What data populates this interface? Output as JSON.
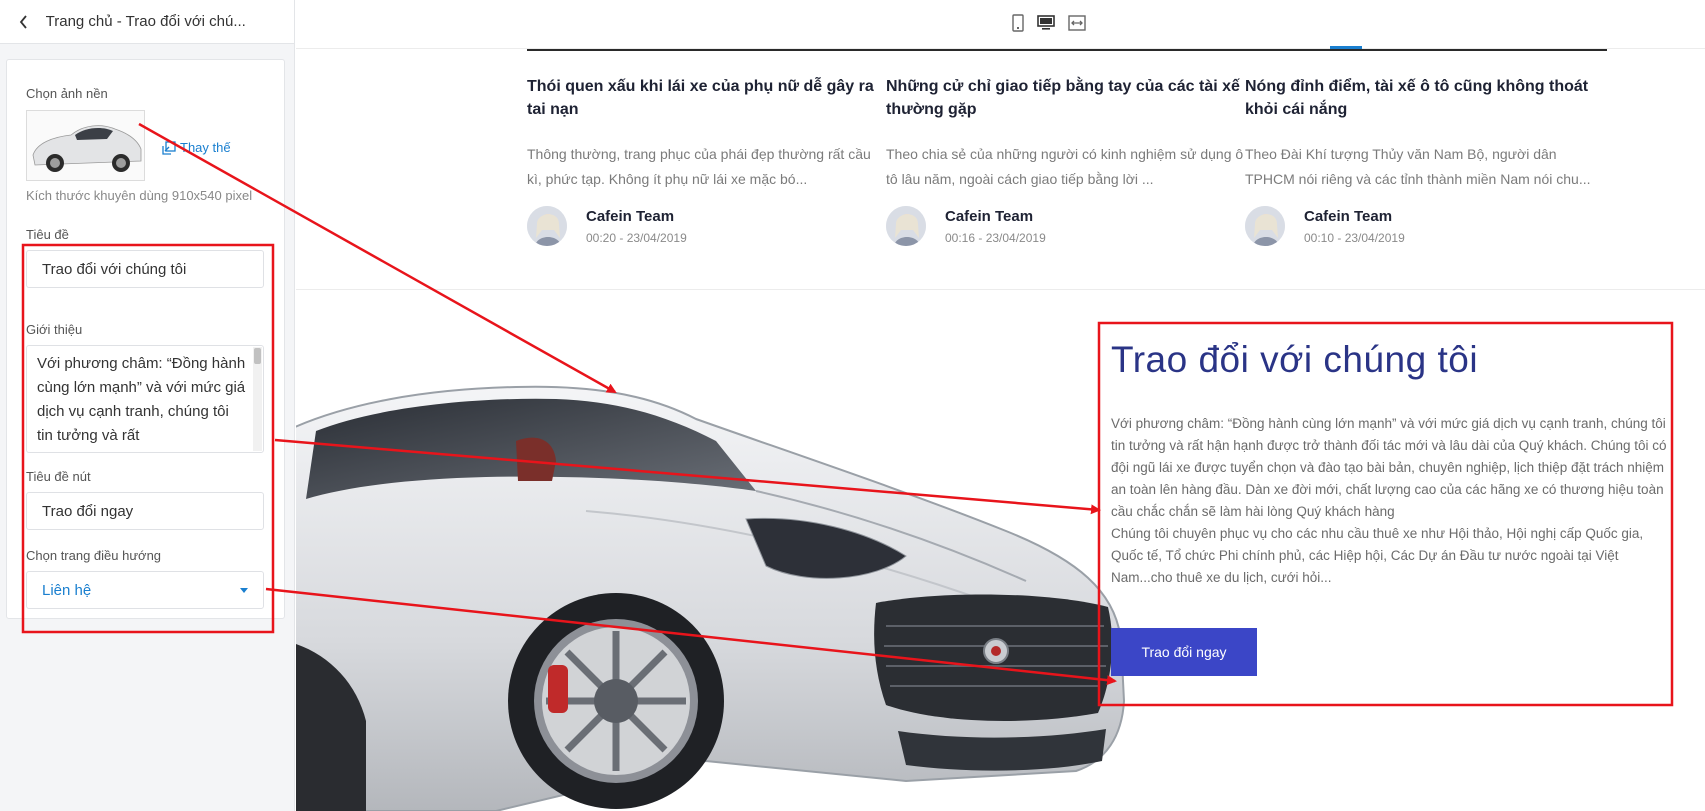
{
  "panel": {
    "title": "Trang chủ - Trao đổi với chú...",
    "bg_label": "Chọn ảnh nền",
    "replace_label": "Thay thế",
    "hint": "Kích thước khuyên dùng 910x540 pixel",
    "title_label": "Tiêu đề",
    "title_value": "Trao đổi với chúng tôi",
    "intro_label": "Giới thiệu",
    "intro_value": "Với phương châm: “Đồng hành cùng lớn mạnh” và với mức giá dịch vụ cạnh tranh, chúng tôi tin tưởng và rất",
    "button_label": "Tiêu đề nút",
    "button_value": "Trao đổi ngay",
    "nav_label": "Chọn trang điều hướng",
    "nav_value": "Liên hệ"
  },
  "toolbar": {
    "devices": [
      "tablet-icon",
      "desktop-icon",
      "fullwidth-icon"
    ],
    "active": "desktop-icon"
  },
  "posts": [
    {
      "title": "Thói quen xấu khi lái xe của phụ nữ dễ gây ra tai nạn",
      "excerpt": "Thông thường, trang phục của phái đẹp thường rất cầu kì, phức tạp. Không ít phụ nữ lái xe mặc bó...",
      "author": "Cafein Team",
      "time": "00:20 - 23/04/2019"
    },
    {
      "title": "Những cử chỉ giao tiếp bằng tay của các tài xế thường gặp",
      "excerpt": "Theo chia sẻ của những người có kinh nghiệm sử dụng ô tô lâu năm, ngoài cách giao tiếp bằng lời ...",
      "author": "Cafein Team",
      "time": "00:16 - 23/04/2019"
    },
    {
      "title": "Nóng đỉnh điểm, tài xế ô tô cũng không thoát khỏi cái nắng",
      "excerpt": "Theo Đài Khí tượng Thủy văn Nam Bộ, người dân TPHCM nói riêng và các tỉnh thành miền Nam nói chu...",
      "author": "Cafein Team",
      "time": "00:10 - 23/04/2019"
    }
  ],
  "contact": {
    "title": "Trao đổi với chúng tôi",
    "desc_1": "Với phương châm: “Đồng hành cùng lớn mạnh” và với mức giá dịch vụ cạnh tranh, chúng tôi tin tưởng và rất hận hạnh được trở thành đối tác mới và lâu dài của Quý khách. Chúng tôi có đội ngũ lái xe được tuyển chọn và đào tạo bài bản, chuyên nghiệp, lịch thiệp đặt trách nhiệm an toàn lên hàng đầu. Dàn xe đời mới, chất lượng cao của các hãng xe có thương hiệu toàn cầu chắc chắn sẽ làm hài lòng Quý khách hàng",
    "desc_2": "Chúng tôi chuyên phục vụ cho các nhu cầu thuê xe như Hội thảo, Hội nghị cấp Quốc gia, Quốc tế, Tổ chức Phi chính phủ, các Hiệp hội, Các Dự án Đầu tư nước ngoài tại Việt Nam...cho thuê xe du lịch, cưới hỏi...",
    "button": "Trao đổi ngay"
  },
  "colors": {
    "annotation": "#e8141b",
    "accent": "#1a7fcf",
    "contact_title": "#2a3486",
    "contact_button": "#3b46c7"
  }
}
